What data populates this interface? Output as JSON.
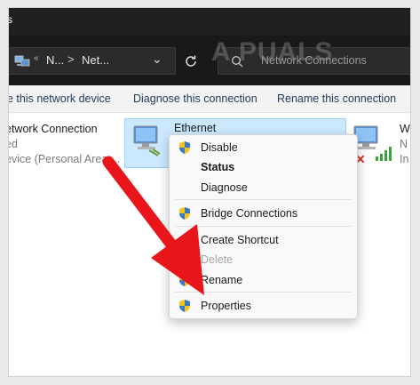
{
  "window": {
    "title": "s"
  },
  "address": {
    "crumb1": "N...",
    "crumb2": "Net...",
    "separator": ">",
    "search_placeholder": "Network Connections"
  },
  "watermark": "A PUALS",
  "toolbar": {
    "disable_device": "e this network device",
    "diagnose": "Diagnose this connection",
    "rename": "Rename this connection"
  },
  "items": {
    "left": {
      "name": "etwork Connection",
      "status": "ed",
      "device": "evice (Personal Area ..."
    },
    "ethernet": {
      "name": "Ethernet"
    },
    "right": {
      "name": "W",
      "line2": "N",
      "line3": "In"
    }
  },
  "context_menu": {
    "disable": "Disable",
    "status": "Status",
    "diagnose": "Diagnose",
    "bridge": "Bridge Connections",
    "create_shortcut": "Create Shortcut",
    "delete": "Delete",
    "rename": "Rename",
    "properties": "Properties"
  },
  "colors": {
    "selection": "#cce8ff",
    "arrow": "#e8151b",
    "titlebar": "#202020"
  }
}
